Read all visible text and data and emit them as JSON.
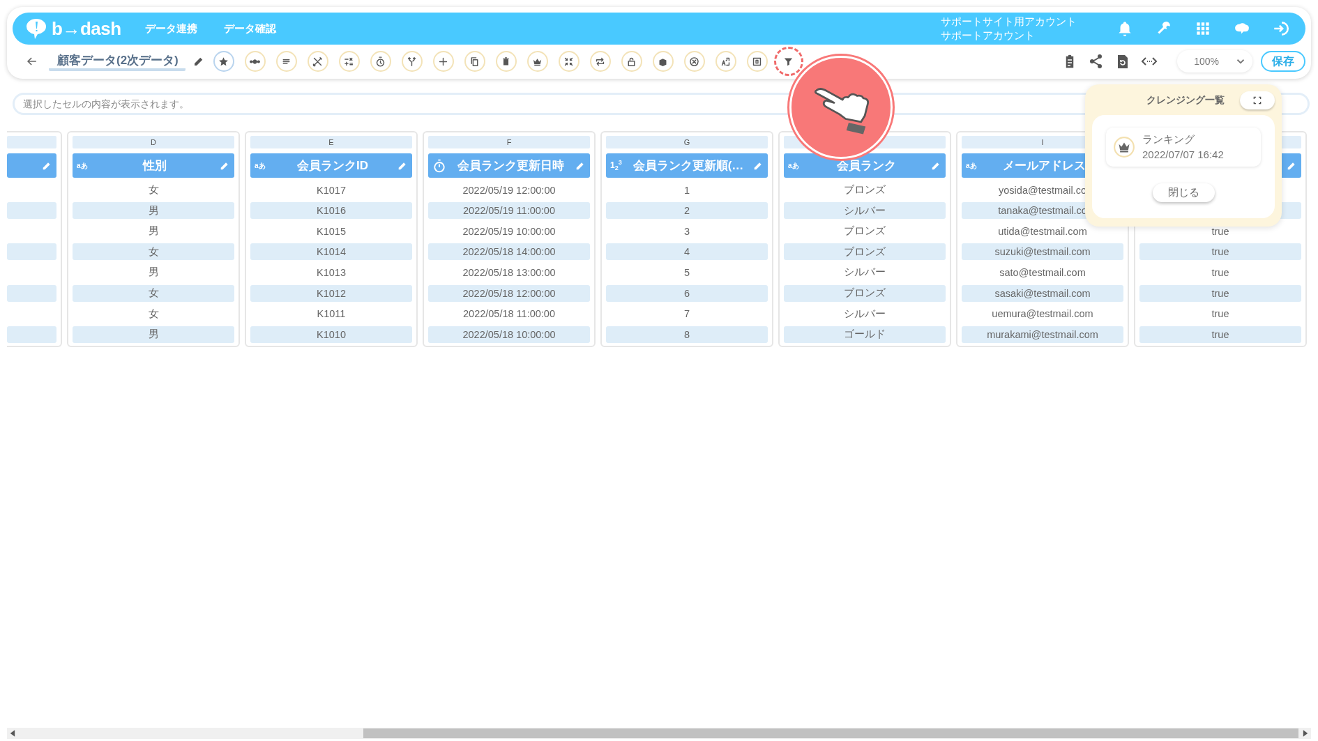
{
  "header": {
    "logo": "b→dash",
    "nav": [
      {
        "label": "データ連携"
      },
      {
        "label": "データ確認"
      }
    ],
    "account": {
      "site": "サポートサイト用アカウント",
      "user": "サポートアカウント"
    }
  },
  "toolbar": {
    "title": "顧客データ(2次データ)",
    "tools": [
      {
        "kind": "star",
        "active": true,
        "highlighted": false,
        "disabled": false
      },
      {
        "kind": "dots",
        "active": false,
        "highlighted": false,
        "disabled": false
      },
      {
        "kind": "lines",
        "active": false,
        "highlighted": false,
        "disabled": false
      },
      {
        "kind": "scissors",
        "active": false,
        "highlighted": false,
        "disabled": false
      },
      {
        "kind": "calc",
        "active": false,
        "highlighted": false,
        "disabled": false
      },
      {
        "kind": "timer",
        "active": false,
        "highlighted": false,
        "disabled": false
      },
      {
        "kind": "merge",
        "active": false,
        "highlighted": false,
        "disabled": false
      },
      {
        "kind": "plus",
        "active": false,
        "highlighted": false,
        "disabled": false
      },
      {
        "kind": "copy",
        "active": false,
        "highlighted": false,
        "disabled": false
      },
      {
        "kind": "trash",
        "active": false,
        "highlighted": false,
        "disabled": false
      },
      {
        "kind": "crown",
        "active": false,
        "highlighted": false,
        "disabled": false
      },
      {
        "kind": "compress",
        "active": false,
        "highlighted": false,
        "disabled": false
      },
      {
        "kind": "repeat",
        "active": false,
        "highlighted": false,
        "disabled": false
      },
      {
        "kind": "lock",
        "active": false,
        "highlighted": false,
        "disabled": false
      },
      {
        "kind": "box",
        "active": false,
        "highlighted": false,
        "disabled": false
      },
      {
        "kind": "xcircle",
        "active": false,
        "highlighted": false,
        "disabled": false
      },
      {
        "kind": "translate",
        "active": false,
        "highlighted": false,
        "disabled": false
      },
      {
        "kind": "zero",
        "active": false,
        "highlighted": false,
        "disabled": false
      },
      {
        "kind": "filter",
        "active": false,
        "highlighted": true,
        "disabled": false
      }
    ],
    "zoom": "100%",
    "save": "保存"
  },
  "cell_bar": {
    "placeholder": "選択したセルの内容が表示されます。"
  },
  "columns": [
    {},
    {
      "letter": "D",
      "kind": "text",
      "type_label": "aあ",
      "name": "性別",
      "cells": [
        "女",
        "男",
        "男",
        "女",
        "男",
        "女",
        "女",
        "男"
      ]
    },
    {
      "letter": "E",
      "kind": "text",
      "type_label": "aあ",
      "name": "会員ランクID",
      "cells": [
        "K1017",
        "K1016",
        "K1015",
        "K1014",
        "K1013",
        "K1012",
        "K1011",
        "K1010"
      ]
    },
    {
      "letter": "F",
      "kind": "datetime",
      "name": "会員ランク更新日時",
      "cells": [
        "2022/05/19 12:00:00",
        "2022/05/19 11:00:00",
        "2022/05/19 10:00:00",
        "2022/05/18 14:00:00",
        "2022/05/18 13:00:00",
        "2022/05/18 12:00:00",
        "2022/05/18 11:00:00",
        "2022/05/18 10:00:00"
      ]
    },
    {
      "letter": "G",
      "kind": "number",
      "type_label": "1$_{2}$$^{3}$",
      "name": "会員ランク更新順(…",
      "cells": [
        "1",
        "2",
        "3",
        "4",
        "5",
        "6",
        "7",
        "8"
      ]
    },
    {
      "kind": "text",
      "type_label": "aあ",
      "name": "会員ランク",
      "cells": [
        "ブロンズ",
        "シルバー",
        "ブロンズ",
        "ブロンズ",
        "シルバー",
        "ブロンズ",
        "シルバー",
        "ゴールド"
      ]
    },
    {
      "letter": "I",
      "kind": "text",
      "type_label": "aあ",
      "name": "メールアドレス",
      "cells": [
        "yosida@testmail.co",
        "tanaka@testmail.co",
        "utida@testmail.com",
        "suzuki@testmail.com",
        "sato@testmail.com",
        "sasaki@testmail.com",
        "uemura@testmail.com",
        "murakami@testmail.com"
      ]
    },
    {
      "cells": [
        "true",
        "true",
        "true",
        "true",
        "true",
        "true"
      ]
    }
  ],
  "popup": {
    "title": "クレンジング一覧",
    "items": [
      {
        "name": "ランキング",
        "date": "2022/07/07 16:42"
      }
    ],
    "close": "閉じる"
  }
}
